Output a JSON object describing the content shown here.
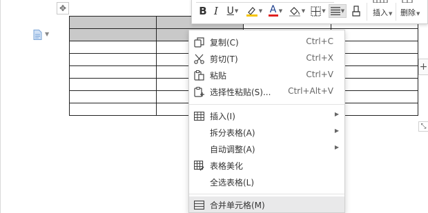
{
  "toolbar": {
    "insert_label": "插入",
    "delete_label": "删除",
    "bold_label": "B",
    "italic_label": "I",
    "underline_label": "U",
    "font_color_label": "A",
    "icons": [
      "bold-icon",
      "italic-icon",
      "underline-icon",
      "highlight-icon",
      "font-color-icon",
      "shading-icon",
      "border-icon",
      "align-icon",
      "format-painter-icon",
      "insert-table-icon",
      "delete-table-icon"
    ],
    "accent_colors": {
      "highlight": "#f5c400",
      "font_color": "#e02020"
    }
  },
  "table": {
    "rows": 8,
    "columns": 4,
    "selected_cells": [
      [
        0,
        0
      ],
      [
        0,
        1
      ],
      [
        1,
        0
      ],
      [
        1,
        1
      ]
    ]
  },
  "context_menu": {
    "items": [
      {
        "label": "复制(C)",
        "shortcut": "Ctrl+C",
        "icon": "copy-icon",
        "submenu": false
      },
      {
        "label": "剪切(T)",
        "shortcut": "Ctrl+X",
        "icon": "cut-icon",
        "submenu": false
      },
      {
        "label": "粘贴",
        "shortcut": "Ctrl+V",
        "icon": "paste-icon",
        "submenu": false
      },
      {
        "label": "选择性粘贴(S)...",
        "shortcut": "Ctrl+Alt+V",
        "icon": "paste-special-icon",
        "submenu": false
      },
      {
        "label": "插入(I)",
        "shortcut": "",
        "icon": "table-insert-icon",
        "submenu": true
      },
      {
        "label": "拆分表格(A)",
        "shortcut": "",
        "icon": "",
        "submenu": true
      },
      {
        "label": "自动调整(A)",
        "shortcut": "",
        "icon": "",
        "submenu": true
      },
      {
        "label": "表格美化",
        "shortcut": "",
        "icon": "table-beautify-icon",
        "submenu": false
      },
      {
        "label": "全选表格(L)",
        "shortcut": "",
        "icon": "",
        "submenu": false
      },
      {
        "label": "合并单元格(M)",
        "shortcut": "",
        "icon": "merge-cells-icon",
        "submenu": false
      }
    ],
    "highlighted_index": 9,
    "highlight_color": "#e9e9ea"
  },
  "side_controls": {
    "add_column_symbol": "+",
    "resize_symbol": "⤡",
    "move_symbol": "✥"
  }
}
